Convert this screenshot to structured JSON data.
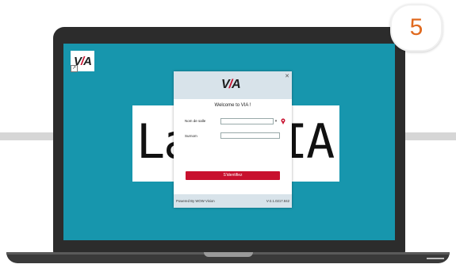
{
  "badge": {
    "step": "5"
  },
  "desktop": {
    "icon_label": "VIA",
    "icon_accent": "#c8102e"
  },
  "background_text": {
    "left": "La",
    "right": "IA"
  },
  "dialog": {
    "welcome": "Welcome to VIA !",
    "room_label": "Nom de salle",
    "name_label": "Surnom",
    "submit_label": "S'identifiez",
    "footer_left": "Powered By WOW Vision",
    "footer_right": "V-2.1.0217.842",
    "logo_text": "VIA"
  },
  "colors": {
    "screen": "#1796ad",
    "accent": "#c8102e",
    "badge_number": "#e06a1f"
  }
}
